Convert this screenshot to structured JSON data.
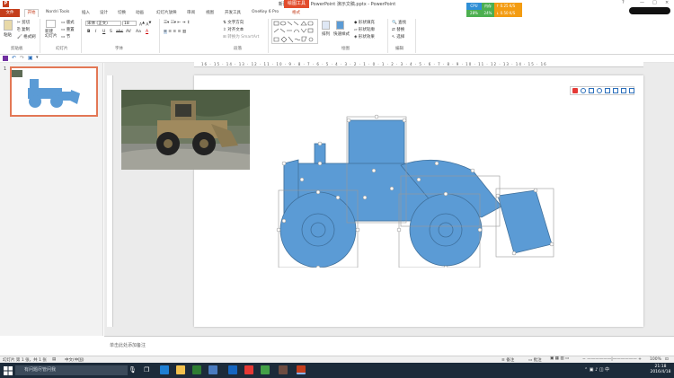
{
  "window": {
    "title": "新建 Microsoft PowerPoint 演示文稿.pptx - PowerPoint",
    "app_icon": "P",
    "contextual_tab_group": "绘图工具",
    "controls": [
      "?",
      "—",
      "□",
      "×"
    ]
  },
  "system_monitor": {
    "cpu_label": "CPU",
    "mem_label": "内存",
    "cpu_value": "28%",
    "mem_value": "24%",
    "upload": "0.25 K/S",
    "download": "0.50 K/S"
  },
  "tabs": [
    "文件",
    "开始",
    "Nordri Tools",
    "插入",
    "设计",
    "切换",
    "动画",
    "幻灯片放映",
    "审阅",
    "视图",
    "开发工具",
    "OneKey 6 Pro",
    "格式"
  ],
  "ribbon": {
    "clipboard": {
      "paste": "粘贴",
      "cut": "剪切",
      "copy": "复制",
      "format_painter": "格式刷",
      "group": "剪贴板"
    },
    "slides": {
      "new_slide": "新建\n幻灯片",
      "layout": "版式",
      "reset": "重置",
      "section": "节",
      "group": "幻灯片"
    },
    "font": {
      "font_name": "宋体 (正文)",
      "font_size": "18",
      "bold": "B",
      "italic": "I",
      "underline": "U",
      "shadow": "S",
      "strike": "abc",
      "char_spacing": "AV",
      "case": "Aa",
      "color": "A",
      "group": "字体"
    },
    "paragraph": {
      "text_direction": "文字方向",
      "align_text": "对齐文本",
      "smartart": "转换为 SmartArt",
      "group": "段落"
    },
    "drawing": {
      "arrange": "排列",
      "quick_styles": "快速样式",
      "shape_fill": "形状填充",
      "shape_outline": "形状轮廓",
      "shape_effects": "形状效果",
      "group": "绘图"
    },
    "editing": {
      "find": "查找",
      "replace": "替换",
      "select": "选择",
      "group": "编辑"
    }
  },
  "slide_panel": {
    "slide_number": "1"
  },
  "ruler": {
    "horizontal_ticks": "16 · 15 · 14 · 13 · 12 · 11 · 10 · 9 · 8 · 7 · 6 · 5 · 4 · 3 · 2 · 1 · 0 · 1 · 2 · 3 · 4 · 5 · 6 · 7 · 8 · 9 · 10 · 11 · 12 · 13 · 14 · 15 · 16"
  },
  "notes": {
    "placeholder": "单击此处添加备注"
  },
  "status": {
    "slide_of": "幻灯片 第 1 张，共 1 张",
    "language": "中文(中国)",
    "notes_btn": "备注",
    "comments_btn": "批注",
    "zoom": "100%"
  },
  "taskbar": {
    "search_placeholder": "有问题尽管问我",
    "time": "21:18",
    "date": "2016/4/18"
  },
  "colors": {
    "accent": "#c43e1c",
    "shape_fill": "#5b9bd5",
    "shape_outline": "#41719c"
  }
}
